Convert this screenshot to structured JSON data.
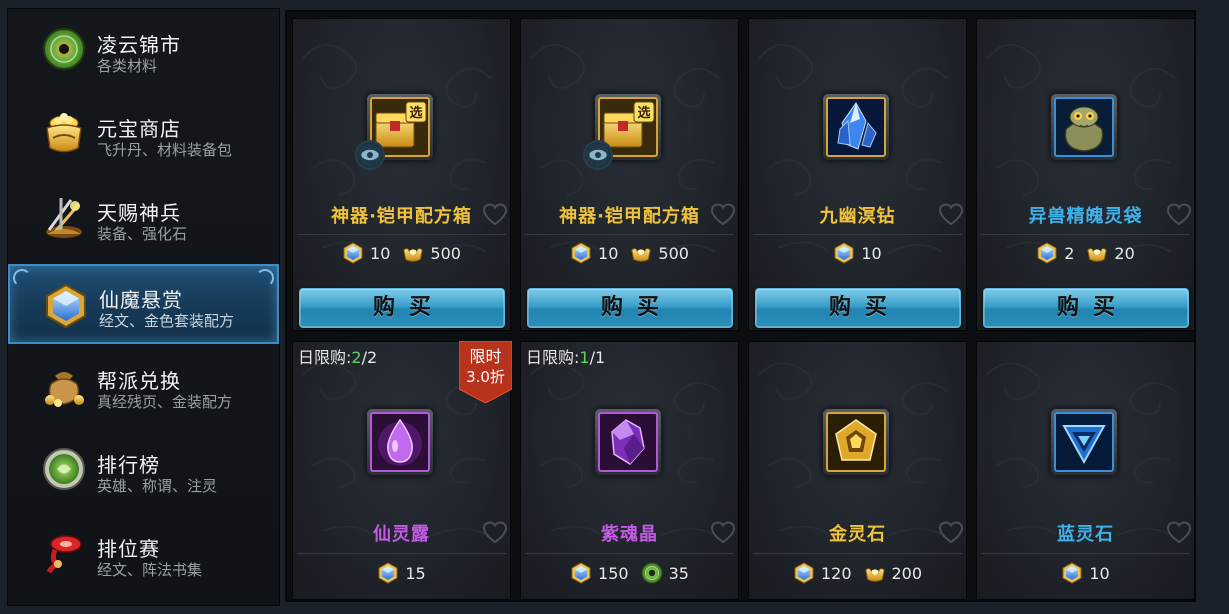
{
  "sidebar": {
    "items": [
      {
        "title": "凌云锦市",
        "subtitle": "各类材料",
        "icon": "jade-disc-icon",
        "active": false
      },
      {
        "title": "元宝商店",
        "subtitle": "飞升丹、材料装备包",
        "icon": "gold-pot-icon",
        "active": false
      },
      {
        "title": "天赐神兵",
        "subtitle": "装备、强化石",
        "icon": "weapons-icon",
        "active": false
      },
      {
        "title": "仙魔悬赏",
        "subtitle": "经文、金色套装配方",
        "icon": "blue-crystal-icon",
        "active": true
      },
      {
        "title": "帮派兑换",
        "subtitle": "真经残页、金装配方",
        "icon": "money-bag-icon",
        "active": false
      },
      {
        "title": "排行榜",
        "subtitle": "英雄、称谓、注灵",
        "icon": "green-medal-icon",
        "active": false
      },
      {
        "title": "排位赛",
        "subtitle": "经文、阵法书集",
        "icon": "red-scroll-icon",
        "active": false
      }
    ]
  },
  "shop": {
    "buy_label": "购买",
    "items": [
      {
        "name": "神器·铠甲配方箱",
        "name_color": "#f0c23a",
        "icon": "golden-chest-icon",
        "frame": "gold",
        "has_preview": true,
        "prices": [
          {
            "currency": "crystal",
            "amount": "10"
          },
          {
            "currency": "ingot",
            "amount": "500"
          }
        ]
      },
      {
        "name": "神器·铠甲配方箱",
        "name_color": "#f0c23a",
        "icon": "golden-chest-icon",
        "frame": "gold",
        "has_preview": true,
        "prices": [
          {
            "currency": "crystal",
            "amount": "10"
          },
          {
            "currency": "ingot",
            "amount": "500"
          }
        ]
      },
      {
        "name": "九幽溟钻",
        "name_color": "#f0c23a",
        "icon": "blue-diamond-icon",
        "frame": "gold",
        "has_preview": false,
        "prices": [
          {
            "currency": "crystal",
            "amount": "10"
          }
        ]
      },
      {
        "name": "异兽精魄灵袋",
        "name_color": "#3fb0e8",
        "icon": "beast-bag-icon",
        "frame": "blue",
        "has_preview": false,
        "prices": [
          {
            "currency": "crystal",
            "amount": "2"
          },
          {
            "currency": "ingot",
            "amount": "20"
          }
        ]
      },
      {
        "name": "仙灵露",
        "name_color": "#c45ae6",
        "icon": "purple-drop-icon",
        "frame": "purple",
        "limit_label": "日限购:",
        "limit_count": "2",
        "limit_total": "/2",
        "tag_line1": "限时",
        "tag_line2": "3.0折",
        "prices": [
          {
            "currency": "crystal",
            "amount": "15"
          }
        ]
      },
      {
        "name": "紫魂晶",
        "name_color": "#c45ae6",
        "icon": "purple-crystal-icon",
        "frame": "purple",
        "limit_label": "日限购:",
        "limit_count": "1",
        "limit_total": "/1",
        "prices": [
          {
            "currency": "crystal",
            "amount": "150"
          },
          {
            "currency": "jade",
            "amount": "35"
          }
        ]
      },
      {
        "name": "金灵石",
        "name_color": "#f0c23a",
        "icon": "gold-stone-icon",
        "frame": "gold",
        "prices": [
          {
            "currency": "crystal",
            "amount": "120"
          },
          {
            "currency": "ingot",
            "amount": "200"
          }
        ]
      },
      {
        "name": "蓝灵石",
        "name_color": "#3fb0e8",
        "icon": "blue-stone-icon",
        "frame": "blue",
        "prices": [
          {
            "currency": "crystal",
            "amount": "10"
          }
        ]
      }
    ]
  }
}
